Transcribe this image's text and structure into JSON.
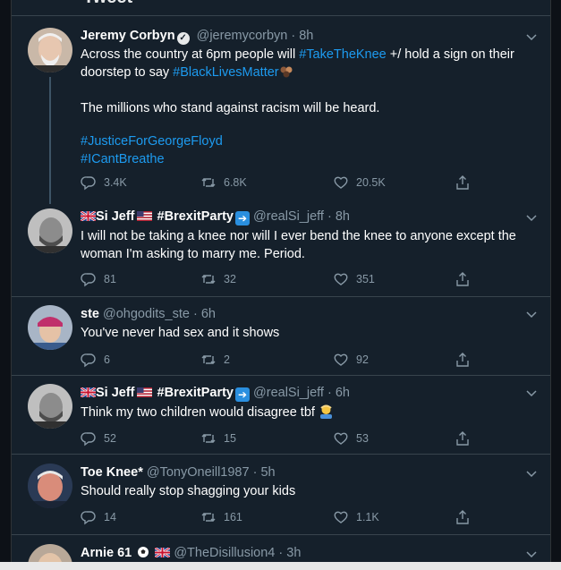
{
  "top_fragment": "Tweet",
  "tweets": [
    {
      "name": "Jeremy Corbyn",
      "handle": "@jeremycorbyn",
      "time": "· 8h",
      "line1_a": "Across the country at 6pm people will ",
      "line1_tag": "#TakeTheKnee",
      "line1_b": " +/ hold a sign on their",
      "line2_a": "doorstep to say ",
      "line2_tag": "#BlackLivesMatter",
      "para2": "The millions who stand against racism will be heard.",
      "tag3": "#JusticeForGeorgeFloyd",
      "tag4": "#ICantBreathe",
      "replies": "3.4K",
      "retweets": "6.8K",
      "likes": "20.5K"
    },
    {
      "name": "Si Jeff",
      "name2": "#BrexitParty",
      "handle": "@realSi_jeff",
      "time": "· 8h",
      "line1": "I will not be taking a knee nor will I ever bend the knee to anyone except the",
      "line2": "woman I'm asking to marry me. Period.",
      "replies": "81",
      "retweets": "32",
      "likes": "351"
    },
    {
      "name": "ste",
      "handle": "@ohgodits_ste",
      "time": "· 6h",
      "line1": "You've never had sex and it shows",
      "replies": "6",
      "retweets": "2",
      "likes": "92"
    },
    {
      "name": "Si Jeff",
      "name2": "#BrexitParty",
      "handle": "@realSi_jeff",
      "time": "· 6h",
      "line1": "Think my two children would disagree tbf",
      "replies": "52",
      "retweets": "15",
      "likes": "53"
    },
    {
      "name": "Toe Knee*",
      "handle": "@TonyOneill1987",
      "time": "· 5h",
      "line1": "Should really stop shagging your kids",
      "replies": "14",
      "retweets": "161",
      "likes": "1.1K"
    },
    {
      "name": "Arnie 61",
      "handle": "@TheDisillusion4",
      "time": "· 3h"
    }
  ],
  "colors": {
    "background": "#15202b",
    "link": "#1d9bf0",
    "muted": "#8899a6",
    "text": "#ffffff"
  },
  "icons": [
    "verified-badge-icon",
    "uk-flag-icon",
    "us-flag-icon",
    "right-arrow-icon",
    "reply-icon",
    "retweet-icon",
    "like-icon",
    "share-icon",
    "chevron-down-icon",
    "fist-emoji-icon",
    "facepalm-emoji-icon",
    "football-icon"
  ]
}
